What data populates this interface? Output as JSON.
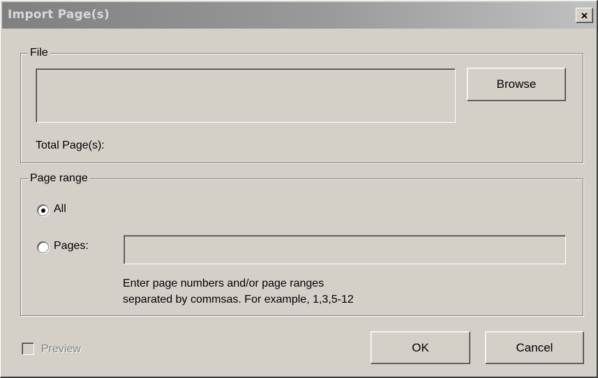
{
  "window": {
    "title": "Import Page(s)",
    "close_glyph": "×"
  },
  "file_group": {
    "label": "File",
    "path_value": "",
    "browse_label": "Browse",
    "total_pages_label": "Total Page(s):"
  },
  "range_group": {
    "label": "Page range",
    "options": [
      {
        "label": "All",
        "selected": true
      },
      {
        "label": "Pages:",
        "selected": false
      }
    ],
    "pages_value": "",
    "hint_line1": "Enter page numbers and/or page ranges",
    "hint_line2": "separated by commsas. For example, 1,3,5-12"
  },
  "footer": {
    "preview_label": "Preview",
    "preview_checked": false,
    "preview_enabled": false,
    "ok_label": "OK",
    "cancel_label": "Cancel"
  },
  "colors": {
    "face": "#d4d0c8",
    "titlebar_start": "#808080",
    "titlebar_end": "#c0c0c0",
    "disabled_text": "#808080"
  }
}
